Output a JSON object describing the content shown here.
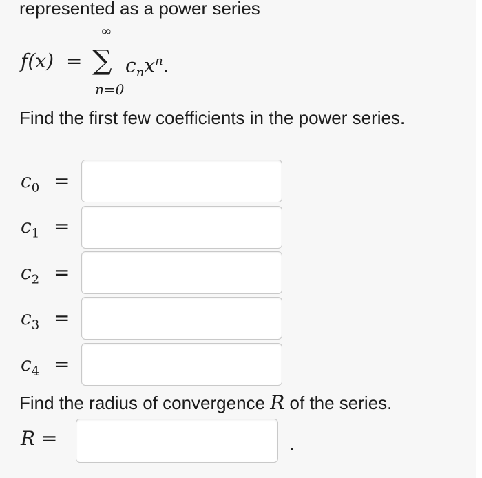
{
  "intro_text": "represented as a power series",
  "formula": {
    "lhs": "f(x)",
    "eq": "=",
    "sum_symbol": "∑",
    "upper_limit": "∞",
    "lower_limit": "n=0",
    "term_coef": "c",
    "term_coef_sub": "n",
    "term_var": "x",
    "term_exp": "n",
    "period": "."
  },
  "prompt_coefficients": "Find the first few coefficients in the power series.",
  "coefficients": [
    {
      "var": "c",
      "sub": "0",
      "eq": "=",
      "value": ""
    },
    {
      "var": "c",
      "sub": "1",
      "eq": "=",
      "value": ""
    },
    {
      "var": "c",
      "sub": "2",
      "eq": "=",
      "value": ""
    },
    {
      "var": "c",
      "sub": "3",
      "eq": "=",
      "value": ""
    },
    {
      "var": "c",
      "sub": "4",
      "eq": "=",
      "value": ""
    }
  ],
  "prompt_radius": {
    "before": "Find the radius of convergence ",
    "var": "R",
    "after": " of the series."
  },
  "radius": {
    "var": "R",
    "eq": "=",
    "value": "",
    "trailing": "."
  }
}
